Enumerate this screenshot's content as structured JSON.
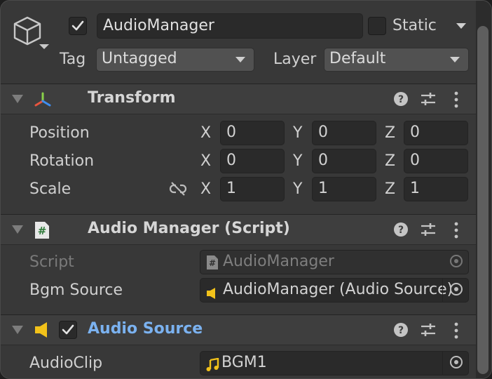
{
  "object": {
    "name": "AudioManager",
    "active": true,
    "static_label": "Static",
    "static": false,
    "tag_label": "Tag",
    "tag_value": "Untagged",
    "layer_label": "Layer",
    "layer_value": "Default"
  },
  "transform": {
    "title": "Transform",
    "rows": [
      {
        "label": "Position",
        "x": "0",
        "y": "0",
        "z": "0"
      },
      {
        "label": "Rotation",
        "x": "0",
        "y": "0",
        "z": "0"
      },
      {
        "label": "Scale",
        "x": "1",
        "y": "1",
        "z": "1"
      }
    ],
    "axes": {
      "x": "X",
      "y": "Y",
      "z": "Z"
    }
  },
  "script_component": {
    "title": "Audio Manager (Script)",
    "script_label": "Script",
    "script_value": "AudioManager",
    "bgm_label": "Bgm Source",
    "bgm_value": "AudioManager (Audio Source)"
  },
  "audio_source": {
    "title": "Audio Source",
    "enabled": true,
    "clip_label": "AudioClip",
    "clip_value": "BGM1"
  },
  "icons": {
    "gameobject": "cube-icon",
    "transform": "transform-axes-icon",
    "script": "csharp-script-icon",
    "audio": "speaker-icon",
    "help": "help-icon",
    "presets": "sliders-icon",
    "more": "kebab-menu-icon",
    "constrain": "link-broken-icon",
    "clip": "music-note-icon"
  },
  "colors": {
    "accent_blue": "#7bb2f0",
    "audio_yellow": "#f2c21a"
  }
}
